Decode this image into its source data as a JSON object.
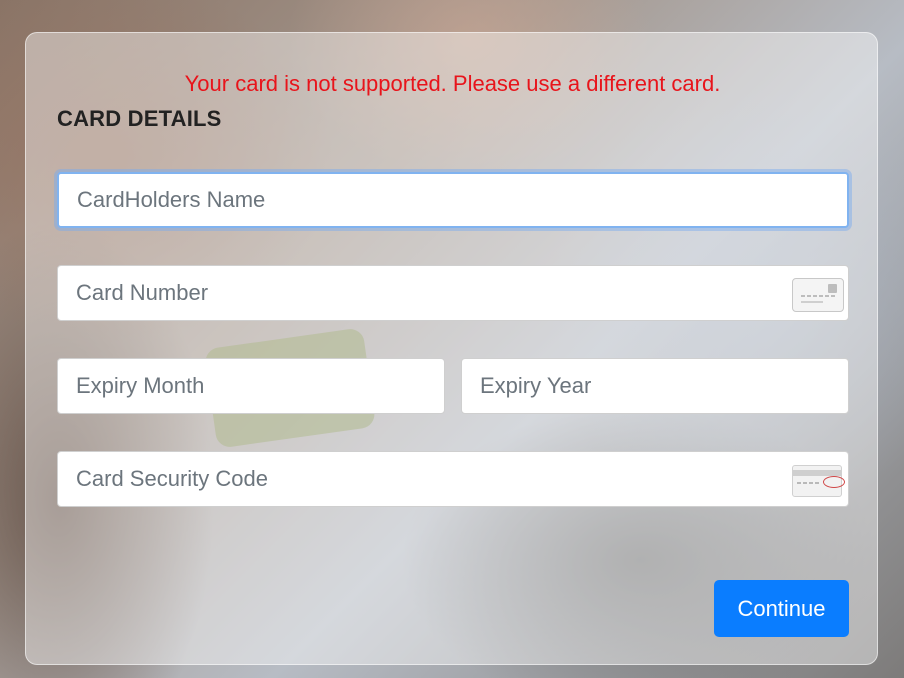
{
  "error_message": "Your card is not supported. Please use a different card.",
  "section_title": "CARD DETAILS",
  "fields": {
    "cardholder_name": {
      "placeholder": "CardHolders Name",
      "value": ""
    },
    "card_number": {
      "placeholder": "Card Number",
      "value": "",
      "icon": "credit-card-icon"
    },
    "expiry_month": {
      "placeholder": "Expiry Month",
      "value": ""
    },
    "expiry_year": {
      "placeholder": "Expiry Year",
      "value": ""
    },
    "security_code": {
      "placeholder": "Card Security Code",
      "value": "",
      "icon": "card-security-code-icon"
    }
  },
  "continue_label": "Continue",
  "colors": {
    "error": "#e8141b",
    "primary_button": "#0a7dff",
    "focus_ring": "#80b3f0"
  }
}
